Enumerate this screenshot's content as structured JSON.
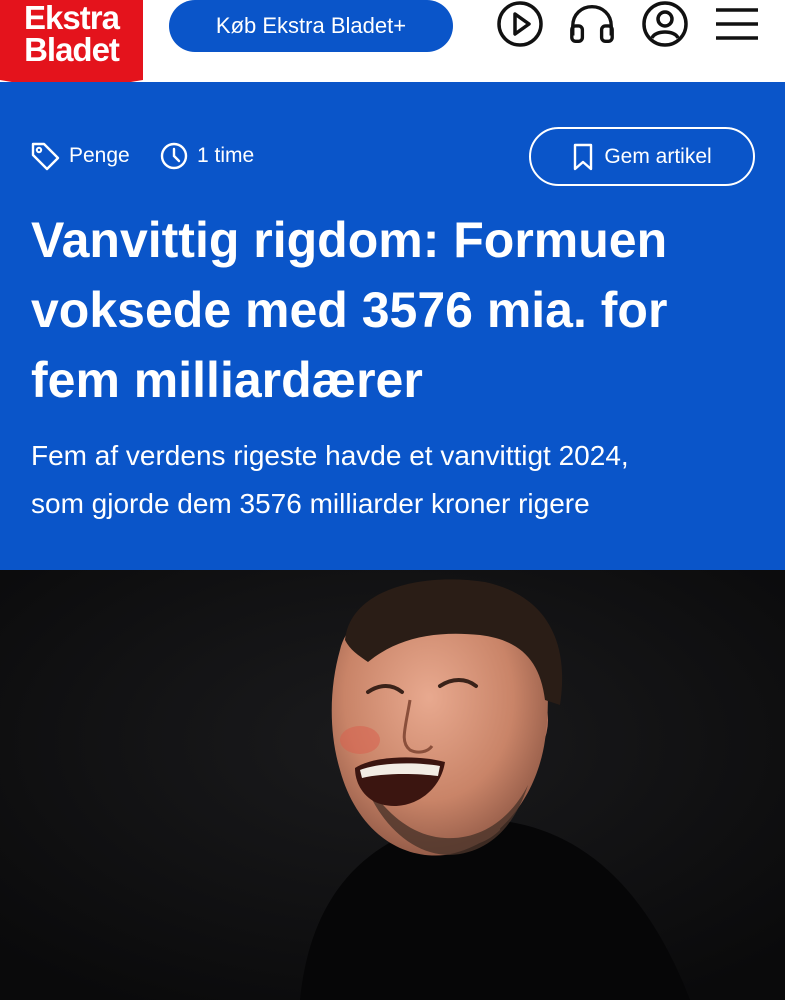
{
  "header": {
    "logo_line1": "Ekstra",
    "logo_line2": "Bladet",
    "buy_label": "Køb Ekstra Bladet+",
    "icons": [
      "play-icon",
      "headphones-icon",
      "user-icon",
      "menu-icon"
    ]
  },
  "article": {
    "category": "Penge",
    "time": "1 time",
    "save_label": "Gem artikel",
    "headline_lines": [
      "Vanvittig rigdom: Formuen",
      "voksede med 3576 mia. for",
      "fem milliardærer"
    ],
    "summary_lines": [
      "Fem af verdens rigeste havde et vanvittigt 2024,",
      "som gjorde dem 3576 milliarder kroner rigere"
    ]
  },
  "colors": {
    "brand_red": "#e4131c",
    "brand_blue": "#0a55c9",
    "photo_bg": "#111112"
  }
}
